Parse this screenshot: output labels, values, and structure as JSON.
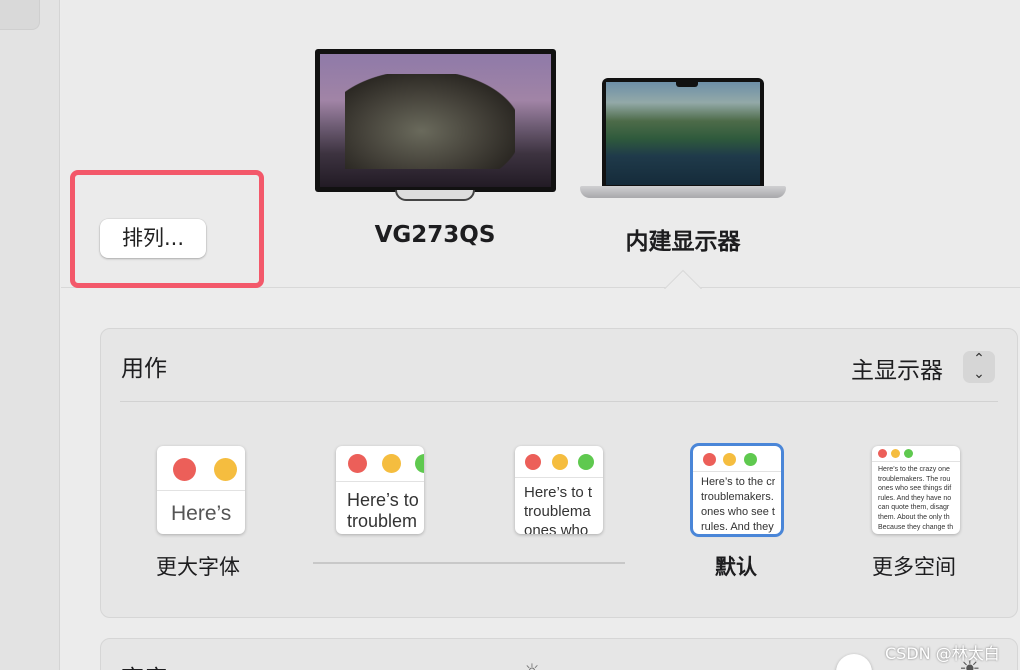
{
  "arrange_button": {
    "label": "排列..."
  },
  "displays": [
    {
      "name": "VG273QS"
    },
    {
      "name": "内建显示器"
    }
  ],
  "use_as": {
    "label": "用作",
    "value": "主显示器",
    "stepper_up": "⌃",
    "stepper_down": "⌄"
  },
  "resolution_options": [
    {
      "label": "更大字体",
      "preview_text": "Here’s"
    },
    {
      "label": "",
      "preview_text": "Here’s to\ntroublem"
    },
    {
      "label": "",
      "preview_text": "Here’s to t\ntroublema\nones who"
    },
    {
      "label": "默认",
      "preview_text": "Here’s to the cr\ntroublemakers.\nones who see t\nrules. And they",
      "selected": true
    },
    {
      "label": "更多空间",
      "preview_text": "Here’s to the crazy one\ntroublemakers. The rou\nones who see things dif\nrules. And they have no\ncan quote them, disagr\nthem. About the only th\nBecause they change th"
    }
  ],
  "brightness": {
    "label": "亮度"
  },
  "watermark": "CSDN @林太白",
  "colors": {
    "highlight": "#f3586a",
    "selected_border": "#4a86d8"
  }
}
